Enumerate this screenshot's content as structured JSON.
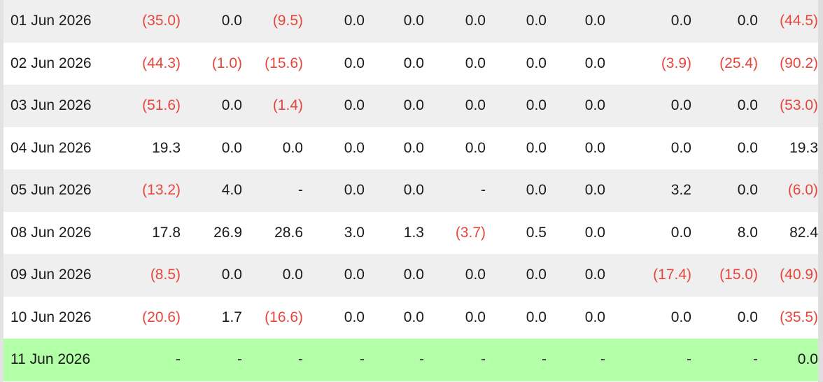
{
  "colors": {
    "negative": "#e8453c",
    "highlight_row": "#b3ffa8",
    "shaded_row": "#efefef"
  },
  "rows": [
    {
      "date": "01 Jun 2026",
      "cells": [
        "(35.0)",
        "0.0",
        "(9.5)",
        "0.0",
        "0.0",
        "0.0",
        "0.0",
        "0.0",
        "0.0",
        "0.0",
        "(44.5)"
      ]
    },
    {
      "date": "02 Jun 2026",
      "cells": [
        "(44.3)",
        "(1.0)",
        "(15.6)",
        "0.0",
        "0.0",
        "0.0",
        "0.0",
        "0.0",
        "(3.9)",
        "(25.4)",
        "(90.2)"
      ]
    },
    {
      "date": "03 Jun 2026",
      "cells": [
        "(51.6)",
        "0.0",
        "(1.4)",
        "0.0",
        "0.0",
        "0.0",
        "0.0",
        "0.0",
        "0.0",
        "0.0",
        "(53.0)"
      ]
    },
    {
      "date": "04 Jun 2026",
      "cells": [
        "19.3",
        "0.0",
        "0.0",
        "0.0",
        "0.0",
        "0.0",
        "0.0",
        "0.0",
        "0.0",
        "0.0",
        "19.3"
      ]
    },
    {
      "date": "05 Jun 2026",
      "cells": [
        "(13.2)",
        "4.0",
        "-",
        "0.0",
        "0.0",
        "-",
        "0.0",
        "0.0",
        "3.2",
        "0.0",
        "(6.0)"
      ]
    },
    {
      "date": "08 Jun 2026",
      "cells": [
        "17.8",
        "26.9",
        "28.6",
        "3.0",
        "1.3",
        "(3.7)",
        "0.5",
        "0.0",
        "0.0",
        "8.0",
        "82.4"
      ]
    },
    {
      "date": "09 Jun 2026",
      "cells": [
        "(8.5)",
        "0.0",
        "0.0",
        "0.0",
        "0.0",
        "0.0",
        "0.0",
        "0.0",
        "(17.4)",
        "(15.0)",
        "(40.9)"
      ]
    },
    {
      "date": "10 Jun 2026",
      "cells": [
        "(20.6)",
        "1.7",
        "(16.6)",
        "0.0",
        "0.0",
        "0.0",
        "0.0",
        "0.0",
        "0.0",
        "0.0",
        "(35.5)"
      ]
    },
    {
      "date": "11 Jun 2026",
      "cells": [
        "-",
        "-",
        "-",
        "-",
        "-",
        "-",
        "-",
        "-",
        "-",
        "-",
        "0.0"
      ]
    }
  ]
}
